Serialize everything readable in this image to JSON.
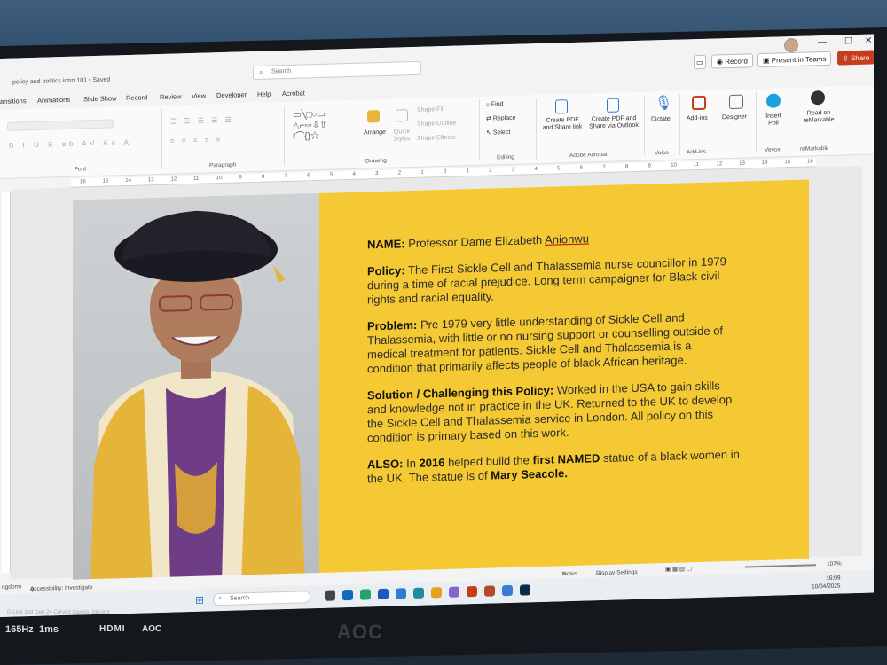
{
  "window": {
    "doc_title": "policy and politics intro 101 • Saved",
    "search_placeholder": "Search",
    "minimize": "—",
    "maximize": "☐",
    "close": "✕",
    "record_label": "Record",
    "present_label": "Present in Teams",
    "share_label": "Share"
  },
  "tabs": [
    "ansitions",
    "Animations",
    "Slide Show",
    "Record",
    "Review",
    "View",
    "Developer",
    "Help",
    "Acrobat"
  ],
  "ribbon": {
    "find": "Find",
    "replace": "Replace",
    "select": "Select",
    "arrange": "Arrange",
    "quick_styles": "Quick Styles",
    "shape_fill": "Shape Fill",
    "shape_outline": "Shape Outline",
    "shape_effects": "Shape Effects",
    "create_pdf_share": "Create PDF and Share link",
    "create_pdf_outlook": "Create PDF and Share via Outlook",
    "dictate": "Dictate",
    "addins": "Add-ins",
    "designer": "Designer",
    "insert_poll": "Insert Poll",
    "read_on_remarkable": "Read on reMarkable",
    "groups": {
      "font": "Font",
      "paragraph": "Paragraph",
      "drawing": "Drawing",
      "editing": "Editing",
      "adobe_acrobat": "Adobe Acrobat",
      "voice": "Voice",
      "addins": "Add-ins",
      "vevox": "Vevox",
      "remarkable": "reMarkable"
    }
  },
  "ruler_ticks": [
    "16",
    "15",
    "14",
    "13",
    "12",
    "11",
    "10",
    "9",
    "8",
    "7",
    "6",
    "5",
    "4",
    "3",
    "2",
    "1",
    "0",
    "1",
    "2",
    "3",
    "4",
    "5",
    "6",
    "7",
    "8",
    "9",
    "10",
    "11",
    "12",
    "13",
    "14",
    "15",
    "16"
  ],
  "slide": {
    "name_label": "NAME:",
    "name_value": "Professor Dame Elizabeth ",
    "name_surname": "Anionwu",
    "policy_label": "Policy:",
    "policy_text": "The First Sickle Cell and Thalassemia nurse councillor in 1979 during a time of racial prejudice. Long term campaigner for Black civil rights and racial equality.",
    "problem_label": "Problem:",
    "problem_text": "Pre 1979 very little understanding of Sickle Cell and Thalassemia, with little or no nursing support or counselling outside of medical treatment for patients. Sickle Cell and Thalassemia is a condition that primarily affects people of black African heritage.",
    "solution_label": "Solution / Challenging this Policy:",
    "solution_text": "Worked in the USA to gain skills and knowledge not in practice in the UK. Returned to the UK to develop the Sickle Cell and Thalassemia service in London. All policy on this condition is primary based on this work.",
    "also_label": "ALSO:",
    "also_t1": "In ",
    "also_year": "2016",
    "also_t2": " helped build the ",
    "also_bold": "first NAMED",
    "also_t3": " statue of a black women in the UK. The statue is of ",
    "also_name": "Mary Seacole."
  },
  "status": {
    "left": "ngdom)",
    "accessibility": "Accessibility: Investigate",
    "notes": "Notes",
    "display_settings": "Display Settings",
    "zoom": "107%"
  },
  "taskbar": {
    "search": "Search",
    "time": "16:09",
    "date": "10/04/2025"
  },
  "bezel": {
    "model": "G Line 2nd Gen 24 Curved Gaming Monitor",
    "hz": "165Hz",
    "ms": "1ms",
    "hdmi": "HDMI",
    "brand_small": "AOC",
    "brand": "AOC"
  },
  "colors": {
    "slide_bg": "#f5c933",
    "share_btn": "#c43e1c",
    "accent_blue": "#2b7cd3"
  }
}
